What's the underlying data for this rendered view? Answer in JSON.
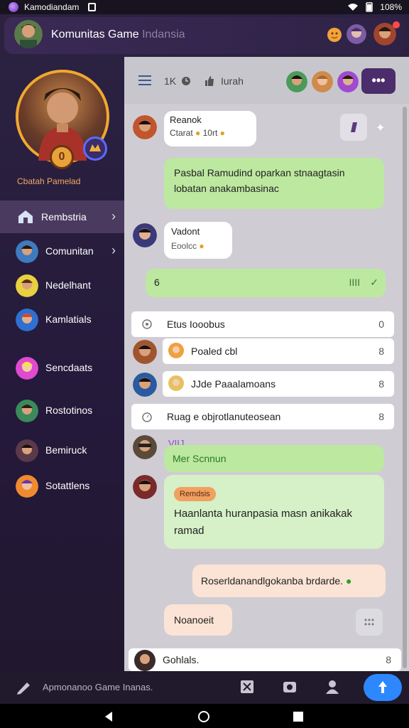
{
  "status_bar": {
    "title": "Kamodiandam",
    "battery": "108%"
  },
  "header": {
    "title_main": "Komunitas Game",
    "title_faded": "Indansia"
  },
  "profile": {
    "name": "Cbatah Pamelad",
    "badge": "0"
  },
  "sidebar": {
    "items": [
      {
        "label": "Rembstria",
        "active": true,
        "chevron": true
      },
      {
        "label": "Comunitan",
        "active": false,
        "chevron": true
      },
      {
        "label": "Nedelhant",
        "active": false,
        "chevron": false
      },
      {
        "label": "Kamlatials",
        "active": false,
        "chevron": false
      },
      {
        "label": "Sencdaats",
        "active": false,
        "chevron": false
      },
      {
        "label": "Rostotinos",
        "active": false,
        "chevron": false
      },
      {
        "label": "Bemiruck",
        "active": false,
        "chevron": false
      },
      {
        "label": "Sotattlens",
        "active": false,
        "chevron": false
      }
    ]
  },
  "chat_header": {
    "label_a": "1K",
    "label_b": "Iurah",
    "more": "•••"
  },
  "messages": {
    "m1": {
      "name": "Reanok",
      "text": "Ctarat",
      "extra": "10rt"
    },
    "m2": {
      "text": "Pasbal Ramudind oparkan stnaagtasin lobatan anakambasinac"
    },
    "m3": {
      "name": "Vadont",
      "text": "Eoolcc"
    },
    "m4": {
      "text": "6",
      "status": "IIII"
    },
    "card1": {
      "text": "Etus Iooobus",
      "end": "0"
    },
    "card2": {
      "text": "Poaled cbl",
      "end": "8"
    },
    "card3": {
      "text": "JJde Paaalamoans",
      "end": "8"
    },
    "card4": {
      "text": "Ruag e objrotlanuteosean",
      "end": "8"
    },
    "m5": {
      "label": "VIIJ",
      "text": "Mer Scnnun"
    },
    "m6": {
      "tag": "Remdsis",
      "text": "Haanlanta huranpasia masn anikakak ramad"
    },
    "m7": {
      "text": "Roserldanandlgokanba brdarde."
    },
    "m8": {
      "text": "Noanoeit"
    },
    "card5": {
      "text": "Gohlals.",
      "end": "8"
    }
  },
  "input": {
    "placeholder": "Apmonanoo Game Inanas."
  },
  "colors": {
    "accent": "#2d88ff",
    "sidebar_bg": "#2b2140",
    "chat_bg": "#cfcdd3"
  }
}
